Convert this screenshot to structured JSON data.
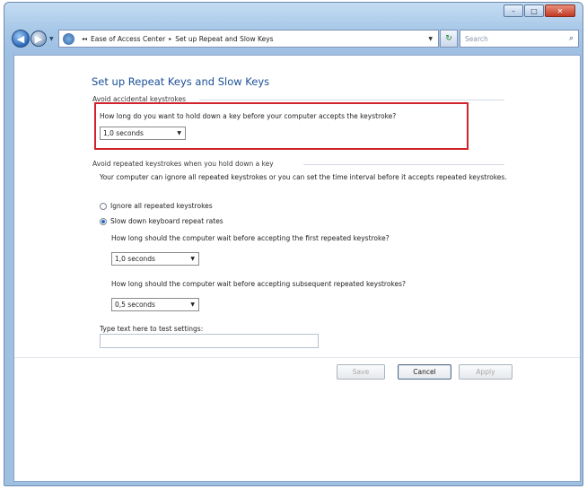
{
  "nav": {
    "breadcrumbs": [
      "Ease of Access Center",
      "Set up Repeat and Slow Keys"
    ],
    "search_placeholder": "Search"
  },
  "page": {
    "title": "Set up Repeat Keys and Slow Keys",
    "section1": {
      "header": "Avoid accidental keystrokes",
      "question": "How long do you want to hold down a key before your computer accepts the keystroke?",
      "selected": "1,0 seconds"
    },
    "section2": {
      "header": "Avoid repeated keystrokes when you hold down a key",
      "description": "Your computer can ignore all repeated keystrokes or you can set the time interval before it accepts repeated keystrokes.",
      "option_ignore": "Ignore all repeated keystrokes",
      "option_slow": "Slow down keyboard repeat rates",
      "q_first": "How long should the computer wait before accepting the first repeated keystroke?",
      "first_selected": "1,0 seconds",
      "q_subsequent": "How long should the computer wait before accepting subsequent repeated keystrokes?",
      "subsequent_selected": "0,5 seconds"
    },
    "test_label": "Type text here to test settings:"
  },
  "buttons": {
    "save": "Save",
    "cancel": "Cancel",
    "apply": "Apply"
  }
}
